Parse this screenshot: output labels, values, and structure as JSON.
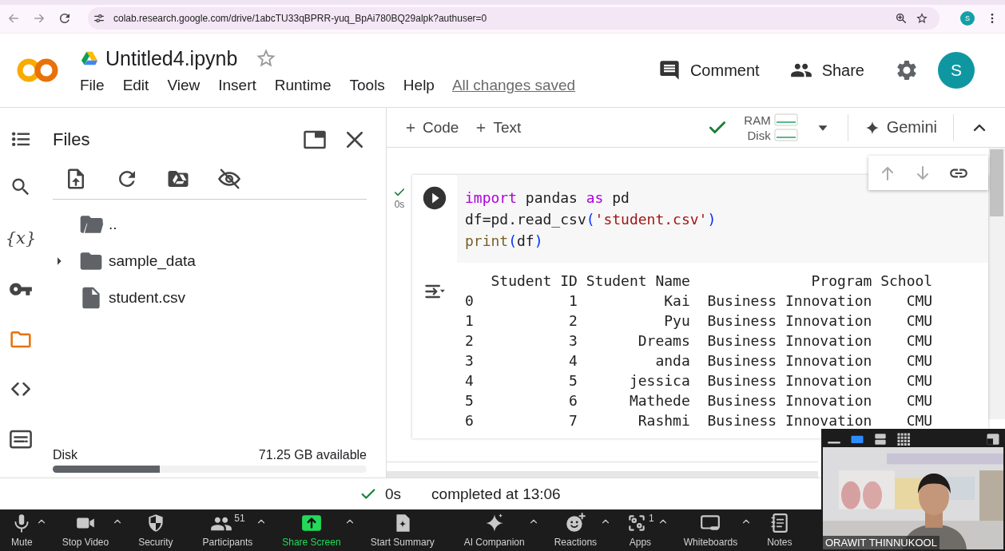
{
  "browser": {
    "url": "colab.research.google.com/drive/1abcTU33qBPRR-yuq_BpAi780BQ29alpk?authuser=0",
    "profile_initial": "S"
  },
  "notebook": {
    "title": "Untitled4.ipynb",
    "starred": false,
    "menu": [
      "File",
      "Edit",
      "View",
      "Insert",
      "Runtime",
      "Tools",
      "Help"
    ],
    "save_status": "All changes saved",
    "actions": [
      "Comment",
      "Share"
    ],
    "avatar_initial": "S"
  },
  "rail": [
    {
      "selected": false
    },
    {
      "selected": false
    },
    {
      "selected": false,
      "glyph": "{x}"
    },
    {
      "selected": false
    },
    {
      "selected": true
    },
    {
      "selected": false
    },
    {
      "selected": false
    }
  ],
  "files": {
    "title": "Files",
    "items": [
      {
        "kind": "parent",
        "name": ".."
      },
      {
        "kind": "folder",
        "name": "sample_data",
        "expanded": false
      },
      {
        "kind": "file",
        "name": "student.csv"
      }
    ],
    "disk": {
      "label": "Disk",
      "available": "71.25 GB available",
      "level": 0.34
    }
  },
  "toolbar": {
    "add": [
      "Code",
      "Text"
    ],
    "connected": true,
    "resources": [
      "RAM",
      "Disk"
    ],
    "assistant": "Gemini"
  },
  "cell": {
    "ran": true,
    "time": "0s",
    "code": [
      [
        {
          "kind": "keyword",
          "text": "import"
        },
        {
          "kind": "plain",
          "text": " pandas "
        },
        {
          "kind": "keyword",
          "text": "as"
        },
        {
          "kind": "plain",
          "text": " pd"
        }
      ],
      [
        {
          "kind": "plain",
          "text": "df=pd.read_csv"
        },
        {
          "kind": "paren",
          "text": "("
        },
        {
          "kind": "string",
          "text": "'student.csv'"
        },
        {
          "kind": "paren",
          "text": ")"
        }
      ],
      [
        {
          "kind": "builtin",
          "text": "print"
        },
        {
          "kind": "paren",
          "text": "("
        },
        {
          "kind": "plain",
          "text": "df"
        },
        {
          "kind": "paren",
          "text": ")"
        }
      ]
    ],
    "output": [
      "   Student ID Student Name              Program School",
      "0           1          Kai  Business Innovation    CMU",
      "1           2          Pyu  Business Innovation    CMU",
      "2           3       Dreams  Business Innovation    CMU",
      "3           4         anda  Business Innovation    CMU",
      "4           5      jessica  Business Innovation    CMU",
      "5           6      Mathede  Business Innovation    CMU",
      "6           7       Rashmi  Business Innovation    CMU"
    ]
  },
  "status": {
    "ok": true,
    "duration": "0s",
    "message": "completed at 13:06"
  },
  "meeting": {
    "items": [
      {
        "label": "Mute",
        "menu": true,
        "highlighted": false
      },
      {
        "label": "Stop Video",
        "menu": true,
        "highlighted": false
      },
      {
        "label": "Security",
        "menu": false,
        "highlighted": false
      },
      {
        "label": "Participants",
        "count": "51",
        "menu": true,
        "highlighted": false
      },
      {
        "label": "Share Screen",
        "menu": true,
        "highlighted": true
      },
      {
        "label": "Start Summary",
        "menu": false,
        "highlighted": false
      },
      {
        "label": "AI Companion",
        "menu": true,
        "highlighted": false
      },
      {
        "label": "Reactions",
        "menu": true,
        "highlighted": false
      },
      {
        "label": "Apps",
        "count": "1",
        "menu": true,
        "highlighted": false
      },
      {
        "label": "Whiteboards",
        "menu": true,
        "highlighted": false
      },
      {
        "label": "Notes",
        "menu": false,
        "highlighted": false
      }
    ],
    "video": {
      "views": [
        {
          "selected": false
        },
        {
          "selected": true
        },
        {
          "selected": false
        },
        {
          "selected": false
        }
      ],
      "participant": "ORAWIT THINNUKOOL",
      "kind": "picture"
    }
  }
}
